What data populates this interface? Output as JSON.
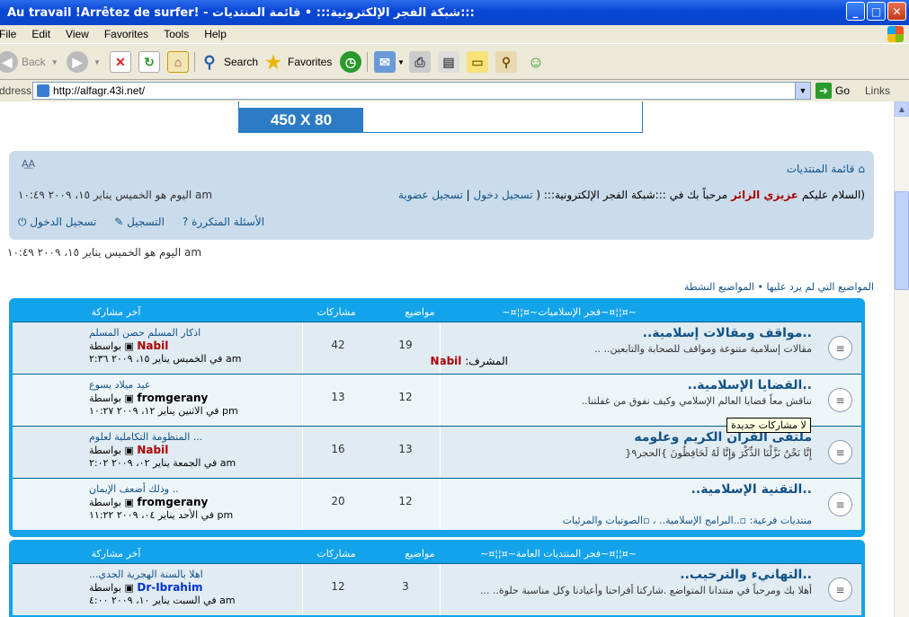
{
  "window": {
    "title": "Au travail !Arrêtez de surfer! - شبكة الفجر الإلكترونية::: • قائمة المنتديات:::"
  },
  "menu": [
    "File",
    "Edit",
    "View",
    "Favorites",
    "Tools",
    "Help"
  ],
  "toolbar": {
    "back": "Back",
    "search": "Search",
    "favorites": "Favorites"
  },
  "address": {
    "label": "Address",
    "url": "http://alfagr.43i.net/",
    "go": "Go",
    "links": "Links"
  },
  "banner": {
    "size_label": "450 X 80"
  },
  "navbar": {
    "home": "قائمة المنتديات",
    "welcome_prefix": "(السلام عليكم",
    "guest": "عزيزي الزائر",
    "welcome_mid": "مرحباً بك في :::شبكة الفجر الإلكترونية::: (",
    "login": "تسجيل دخول",
    "sep": "|",
    "register": "تسجيل عضوية",
    "time": "اليوم هو الخميس يناير ١٥، ٢٠٠٩ ١٠:٤٩ am",
    "links": [
      "تسجيل الدخول",
      "التسجيل",
      "الأسئلة المتكررة"
    ]
  },
  "current_time": "اليوم هو الخميس يناير ١٥، ٢٠٠٩ ١٠:٤٩ am",
  "quick_links": "المواضيع التي لم يرد عليها • المواضيع النشطة",
  "categories": [
    {
      "name": "~¤¦¦¤~فجر الإسلاميات~¤¦¦¤~",
      "col_topics": "مواضيع",
      "col_posts": "مشاركات",
      "col_last": "آخر مشاركة",
      "forums": [
        {
          "title": "..مواقف ومقالات إسلامية..",
          "desc": "مقالات إسلامية متنوعة ومواقف للصحابة والتابعين.. ..",
          "moderator_label": "المشرف:",
          "moderator": "Nabil",
          "topics": "19",
          "posts": "42",
          "last_title": "اذكار المسلم حصن المسلم",
          "last_by": "بواسطة",
          "last_user": "Nabil",
          "last_time": "في الخميس يناير ١٥، ٢٠٠٩ ٢:٣٦ am"
        },
        {
          "title": "..القضايا الإسلامية..",
          "desc": "نناقش معاً قضايا العالم الإسلامي وكيف نفوق من غفلتنا..",
          "topics": "12",
          "posts": "13",
          "last_title": "عيد ميلاد يسوع",
          "last_by": "بواسطة",
          "last_user": "fromgerany",
          "last_time": "في الاثنين يناير ١٢، ٢٠٠٩ ١٠:٢٧ pm"
        },
        {
          "title": "ملتقى القرآن الكريم وعلومه",
          "desc": "إِنَّا نَحْنُ نَزَّلْنَا الذِّكْرَ وَإِنَّا لَهُ لَحَافِظُونَ }الحجر٩{",
          "topics": "13",
          "posts": "16",
          "last_title": "المنظومة التكاملية لعلوم ...",
          "last_by": "بواسطة",
          "last_user": "Nabil",
          "last_time": "في الجمعة يناير ٠٢، ٢٠٠٩ ٢:٠٢ am"
        },
        {
          "title": "..التقنية الإسلامية..",
          "subforums_label": "منتديات فرعية:",
          "subforums": [
            "..البرامج الإسلامية..",
            "الصوتيات والمرئيات"
          ],
          "topics": "12",
          "posts": "20",
          "last_title": "وذلك أضعف الإيمان ..",
          "last_by": "بواسطة",
          "last_user": "fromgerany",
          "last_time": "في الأحد يناير ٠٤، ٢٠٠٩ ١١:٢٢ pm"
        }
      ]
    },
    {
      "name": "~¤¦¦¤~فجر المنتديات العامة~¤¦¦¤~",
      "col_topics": "مواضيع",
      "col_posts": "مشاركات",
      "col_last": "آخر مشاركة",
      "forums": [
        {
          "title": "..التهانيء والترحيب..",
          "desc": "أهلا بك ومرحباً في منتدانا المتواضع .شاركنا أفراحنا وأعيادنا وكل مناسبة حلوة.. ...",
          "topics": "3",
          "posts": "12",
          "last_title": "...اهلا بالسنة الهجرية الجدي",
          "last_by": "بواسطة",
          "last_user": "Dr-Ibrahim",
          "last_time": "في السبت يناير ١٠، ٢٠٠٩ ٤:٠٠ am"
        }
      ]
    }
  ],
  "tooltip": "لا مشاركات جديدة"
}
